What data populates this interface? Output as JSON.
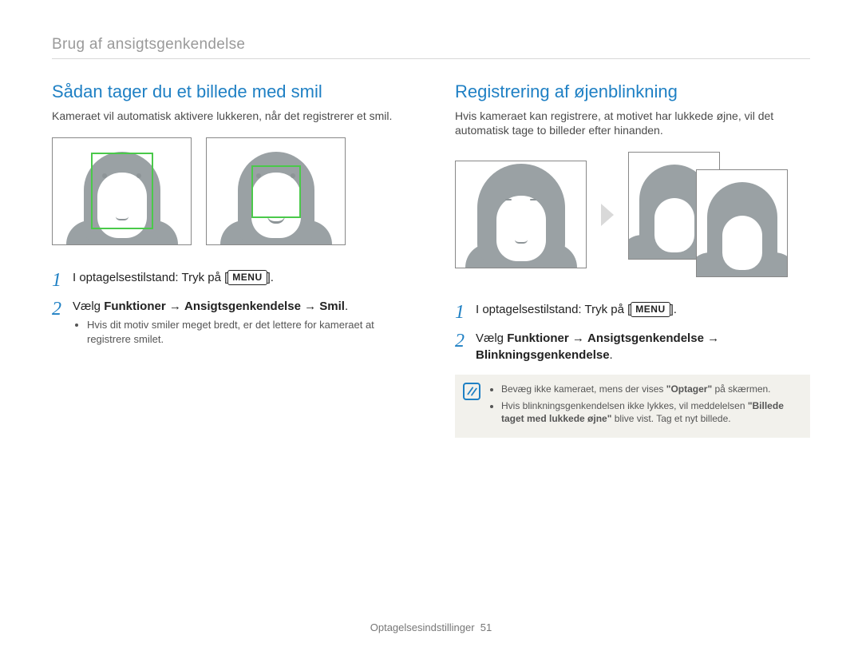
{
  "breadcrumb": "Brug af ansigtsgenkendelse",
  "left": {
    "title": "Sådan tager du et billede med smil",
    "intro": "Kameraet vil automatisk aktivere lukkeren, når det registrerer et smil.",
    "step1_pre": "I optagelsestilstand: Tryk på [",
    "step1_menu": "MENU",
    "step1_post": "].",
    "step2_pre": "Vælg ",
    "step2_b1": "Funktioner",
    "step2_arrow": " → ",
    "step2_b2": "Ansigtsgenkendelse",
    "step2_b3": "Smil",
    "step2_post": ".",
    "bullet": "Hvis dit motiv smiler meget bredt, er det lettere for kameraet at registrere smilet."
  },
  "right": {
    "title": "Registrering af øjenblinkning",
    "intro": "Hvis kameraet kan registrere, at motivet har lukkede øjne, vil det automatisk tage to billeder efter hinanden.",
    "step1_pre": "I optagelsestilstand: Tryk på [",
    "step1_menu": "MENU",
    "step1_post": "].",
    "step2_pre": "Vælg ",
    "step2_b1": "Funktioner",
    "step2_arrow": " → ",
    "step2_b2": "Ansigtsgenkendelse",
    "step2_b3": "Blinkningsgenkendelse",
    "step2_post": ".",
    "note1_pre": "Bevæg ikke kameraet, mens der vises ",
    "note1_b": "\"Optager\"",
    "note1_post": " på skærmen.",
    "note2_pre": "Hvis blinkningsgenkendelsen ikke lykkes, vil meddelelsen ",
    "note2_b": "\"Billede taget med lukkede øjne\"",
    "note2_post": " blive vist. Tag et nyt billede."
  },
  "footer_label": "Optagelsesindstillinger",
  "footer_page": "51",
  "step_numbers": {
    "one": "1",
    "two": "2"
  }
}
